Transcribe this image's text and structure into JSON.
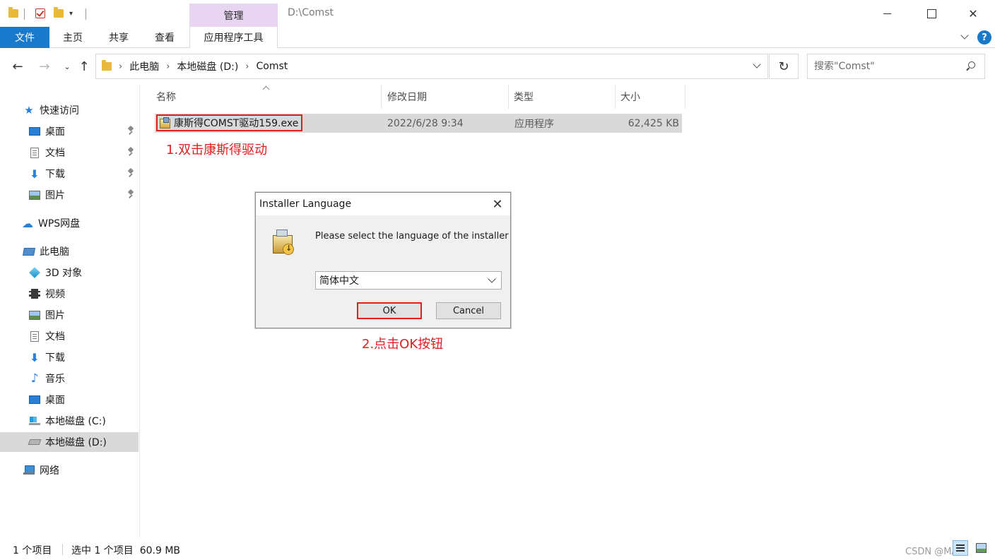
{
  "window": {
    "title_path": "D:\\Comst",
    "contextual_tab": "管理"
  },
  "ribbon": {
    "tabs": [
      "文件",
      "主页",
      "共享",
      "查看",
      "应用程序工具"
    ],
    "help_label": "?"
  },
  "address": {
    "crumbs": [
      "此电脑",
      "本地磁盘 (D:)",
      "Comst"
    ],
    "search_placeholder": "搜索\"Comst\""
  },
  "navpane": {
    "quick_access": "快速访问",
    "quick_items": [
      "桌面",
      "文档",
      "下载",
      "图片"
    ],
    "wps": "WPS网盘",
    "this_pc": "此电脑",
    "pc_items": [
      "3D 对象",
      "视频",
      "图片",
      "文档",
      "下载",
      "音乐",
      "桌面",
      "本地磁盘 (C:)",
      "本地磁盘 (D:)"
    ],
    "network": "网络"
  },
  "filelist": {
    "columns": [
      "名称",
      "修改日期",
      "类型",
      "大小"
    ],
    "rows": [
      {
        "name": "康斯得COMST驱动159.exe",
        "date": "2022/6/28 9:34",
        "type": "应用程序",
        "size": "62,425 KB"
      }
    ]
  },
  "annotations": {
    "step1": "1.双击康斯得驱动",
    "step2": "2.点击OK按钮"
  },
  "dialog": {
    "title": "Installer Language",
    "message": "Please select the language of the installer",
    "selected_language": "简体中文",
    "ok_label": "OK",
    "cancel_label": "Cancel"
  },
  "status": {
    "item_count": "1 个项目",
    "selection": "选中 1 个项目  60.9 MB",
    "watermark": "CSDN @MA王"
  },
  "colors": {
    "accent": "#1979ca",
    "contextual_tab": "#e7d5f2",
    "annotation_red": "#e02020",
    "selection_gray": "#d9d9d9"
  }
}
